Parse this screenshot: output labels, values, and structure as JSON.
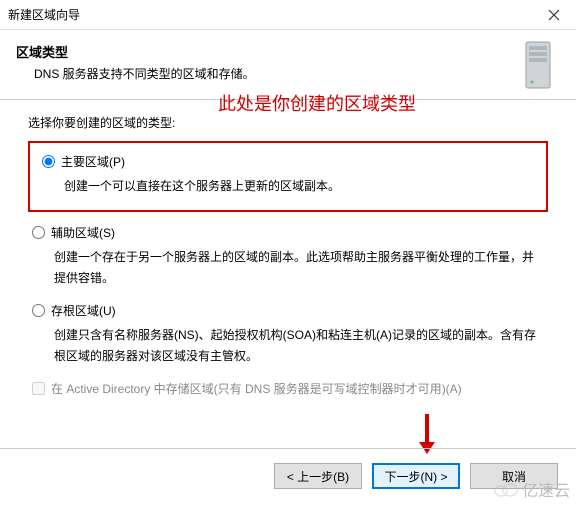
{
  "window": {
    "title": "新建区域向导"
  },
  "header": {
    "title": "区域类型",
    "desc": "DNS 服务器支持不同类型的区域和存储。"
  },
  "annotation": "此处是你创建的区域类型",
  "content": {
    "select_label": "选择你要创建的区域的类型:",
    "primary": {
      "label": "主要区域(P)",
      "desc": "创建一个可以直接在这个服务器上更新的区域副本。"
    },
    "secondary": {
      "label": "辅助区域(S)",
      "desc": "创建一个存在于另一个服务器上的区域的副本。此选项帮助主服务器平衡处理的工作量，并提供容错。"
    },
    "stub": {
      "label": "存根区域(U)",
      "desc": "创建只含有名称服务器(NS)、起始授权机构(SOA)和粘连主机(A)记录的区域的副本。含有存根区域的服务器对该区域没有主管权。"
    },
    "ad_store": "在 Active Directory 中存储区域(只有 DNS 服务器是可写域控制器时才可用)(A)"
  },
  "footer": {
    "back": "< 上一步(B)",
    "next": "下一步(N) >",
    "cancel": "取消"
  },
  "watermark": "亿速云"
}
